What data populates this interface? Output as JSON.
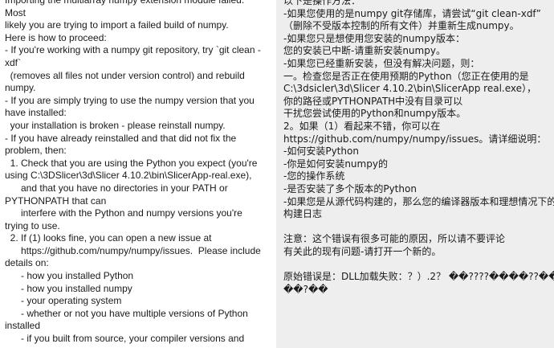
{
  "left_text": {
    "lines": [
      "Importing the multiarray numpy extension module failed.",
      "Most",
      "likely you are trying to import a failed build of numpy.",
      "Here is how to proceed:",
      "- If you're working with a numpy git repository, try `git clean -",
      "xdf`",
      "  (removes all files not under version control) and rebuild",
      "numpy.",
      "- If you are simply trying to use the numpy version that you",
      "have installed:",
      "  your installation is broken - please reinstall numpy.",
      "- If you have already reinstalled and that did not fix the",
      "problem, then:",
      "  1. Check that you are using the Python you expect (you're",
      "using C:\\3DSlicer\\3d\\Slicer 4.10.2\\bin\\SlicerApp-real.exe),",
      "      and that you have no directories in your PATH or",
      "PYTHONPATH that can",
      "      interfere with the Python and numpy versions you're",
      "trying to use.",
      "  2. If (1) looks fine, you can open a new issue at",
      "      https://github.com/numpy/numpy/issues.  Please include",
      "details on:",
      "      - how you installed Python",
      "      - how you installed numpy",
      "      - your operating system",
      "      - whether or not you have multiple versions of Python",
      "installed",
      "      - if you built from source, your compiler versions and"
    ]
  },
  "right_text": {
    "lines": [
      "以下是操作方法：",
      "-如果您使用的是numpy git存储库，请尝试“git clean-xdf”",
      "（删除不受版本控制的所有文件）并重新生成numpy。",
      "-如果您只是想使用您安装的numpy版本：",
      "您的安装已中断-请重新安装numpy。",
      "-如果您已经重新安装，但没有解决问题，则：",
      "一。检查您是否正在使用预期的Python（您正在使用的是",
      "C:\\3dsicler\\3d\\Slicer 4.10.2\\bin\\SlicerApp real.exe），",
      "你的路径或PYTHONPATH中没有目录可以",
      "干扰您尝试使用的Python和numpy版本。",
      "2。如果（1）看起来不错，你可以在",
      "https://github.com/numpy/numpy/issues。请详细说明：",
      "-如何安装Python",
      "-你是如何安装numpy的",
      "-您的操作系统",
      "-是否安装了多个版本的Python",
      "-如果您是从源代码构建的，那么您的编译器版本和理想情况下的",
      "构建日志",
      "",
      "注意：这个错误有很多可能的原因，所以请不要评论",
      "有关此的现有问题-请打开一个新的。",
      "",
      "原始错误是：DLL加载失败：？）.2？ ��????����??��?",
      "��?��"
    ]
  }
}
